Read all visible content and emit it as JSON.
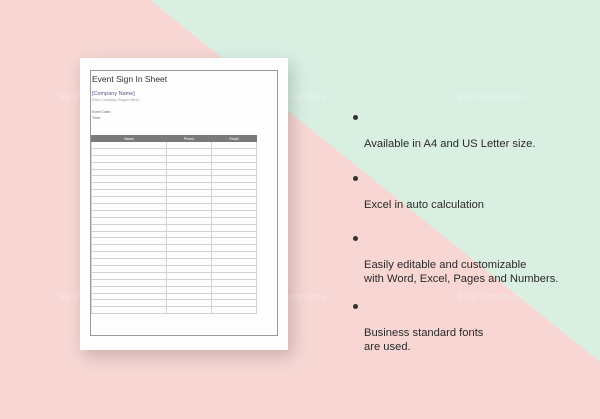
{
  "colors": {
    "pink": "#f7d6d3",
    "mint": "#d9efe2",
    "paper": "#fdfdfd",
    "table_header": "#7a7a7a"
  },
  "document": {
    "title": "Event Sign In Sheet",
    "company_name": "[Company Name]",
    "company_slogan": "[Your Company Slogan Here]",
    "event_date_label": "Event Date:",
    "time_label": "Time:",
    "columns": [
      "Name",
      "Phone",
      "Email"
    ],
    "blank_rows": 25
  },
  "features": [
    {
      "text": "Available in A4 and US Letter size."
    },
    {
      "text": "Excel in auto calculation"
    },
    {
      "text": "Easily editable and customizable\nwith Word, Excel, Pages and Numbers."
    },
    {
      "text": "Business standard fonts\nare used."
    }
  ],
  "watermark": {
    "text": "BestTemplates"
  }
}
